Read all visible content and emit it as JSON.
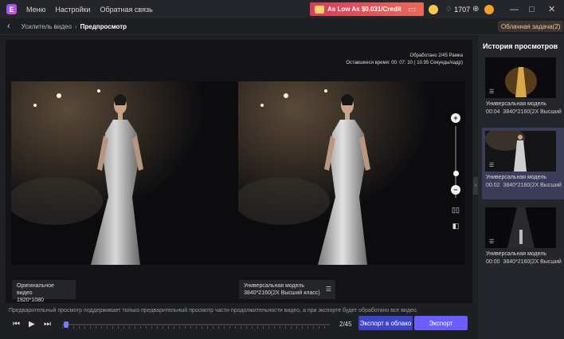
{
  "topbar": {
    "menu": [
      "Меню",
      "Настройки",
      "Обратная связь"
    ],
    "promo": "As Low As $0.031/Credit",
    "credits": "1707"
  },
  "breadcrumb": {
    "parent": "Усилитель видео",
    "current": "Предпросмотр",
    "cloud_task": "Облачная задача(2)"
  },
  "stage": {
    "processed": "Обработано 2/45 Рамка",
    "remaining": "Оставшееся время: 00: 07: 10 ( 10.95 Секунды/кадр)",
    "left_label": "Оригинальное видео",
    "left_res": "1920*1080",
    "right_label": "Универсальная модель",
    "right_res": "3840*2160(2X Высший класс)"
  },
  "notice": "Предварительный просмотр поддерживает только предварительный просмотр части продолжительности видео, а при экспорте будет обработано все видео.",
  "player": {
    "frames": "2/45",
    "cloud_export": "Экспорт в облако",
    "export": "Экспорт"
  },
  "history": {
    "title": "История просмотров",
    "items": [
      {
        "name": "Универсальная модель",
        "time": "00:04",
        "res": "3840*2160(2X Высший"
      },
      {
        "name": "Универсальная модель",
        "time": "00:02",
        "res": "3840*2160(2X Высший"
      },
      {
        "name": "Универсальная модель",
        "time": "00:00",
        "res": "3840*2160(2X Высший"
      }
    ]
  }
}
